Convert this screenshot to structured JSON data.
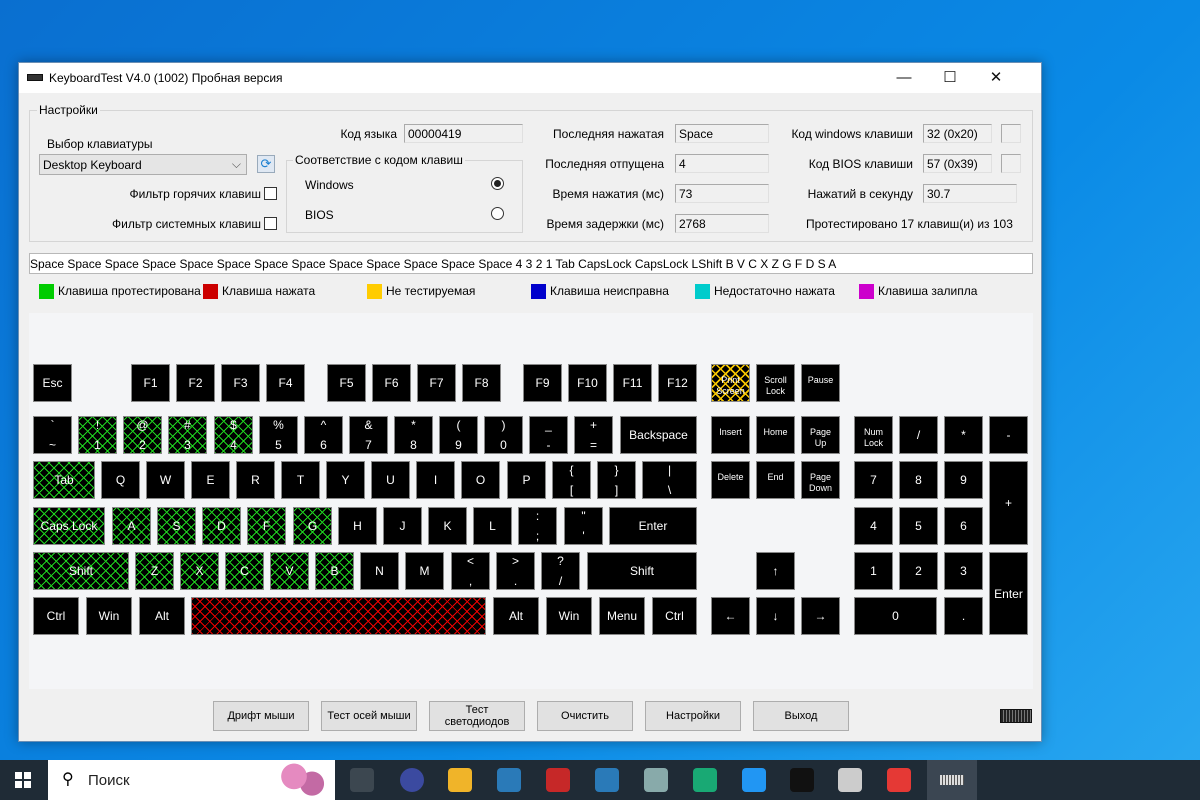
{
  "window": {
    "title": "KeyboardTest V4.0 (1002) Пробная версия",
    "minimize": "—",
    "maximize": "☐",
    "close": "✕"
  },
  "settings": {
    "group_label": "Настройки",
    "keyboard_select_label": "Выбор клавиатуры",
    "keyboard_select_value": "Desktop Keyboard",
    "hotkey_filter_label": "Фильтр горячих клавиш",
    "hotkey_filter_checked": false,
    "system_filter_label": "Фильтр системных клавиш",
    "system_filter_checked": false,
    "lang_code_label": "Код языка",
    "lang_code_value": "00000419",
    "mapping_group_label": "Соответствие с кодом клавиш",
    "mapping_options": [
      {
        "label": "Windows",
        "selected": true
      },
      {
        "label": "BIOS",
        "selected": false
      }
    ],
    "last_pressed_label": "Последняя нажатая",
    "last_pressed_value": "Space",
    "last_released_label": "Последняя отпущена",
    "last_released_value": "4",
    "press_time_label": "Время нажатия (мс)",
    "press_time_value": "73",
    "delay_time_label": "Время задержки (мс)",
    "delay_time_value": "2768",
    "win_code_label": "Код windows клавиши",
    "win_code_value": "32 (0x20)",
    "bios_code_label": "Код BIOS клавиши",
    "bios_code_value": "57 (0x39)",
    "per_second_label": "Нажатий в секунду",
    "per_second_value": "30.7",
    "tested_summary": "Протестировано 17 клавиш(и) из 103"
  },
  "log": "Space Space Space Space Space Space Space Space Space Space Space Space Space 4 3 2 1 Tab CapsLock CapsLock LShift B V C X Z G F D S A",
  "legend": [
    {
      "label": "Клавиша протестирована",
      "color": "#00cc00"
    },
    {
      "label": "Клавиша нажата",
      "color": "#cc0000"
    },
    {
      "label": "Не тестируемая",
      "color": "#ffcc00"
    },
    {
      "label": "Клавиша неисправна",
      "color": "#0000cc"
    },
    {
      "label": "Недостаточно нажата",
      "color": "#00cccc"
    },
    {
      "label": "Клавиша залипла",
      "color": "#cc00cc"
    }
  ],
  "keyboard": {
    "keys": [
      {
        "id": "esc",
        "label": "Esc"
      },
      {
        "id": "f1",
        "label": "F1"
      },
      {
        "id": "f2",
        "label": "F2"
      },
      {
        "id": "f3",
        "label": "F3"
      },
      {
        "id": "f4",
        "label": "F4"
      },
      {
        "id": "f5",
        "label": "F5"
      },
      {
        "id": "f6",
        "label": "F6"
      },
      {
        "id": "f7",
        "label": "F7"
      },
      {
        "id": "f8",
        "label": "F8"
      },
      {
        "id": "f9",
        "label": "F9"
      },
      {
        "id": "f10",
        "label": "F10"
      },
      {
        "id": "f11",
        "label": "F11"
      },
      {
        "id": "f12",
        "label": "F12"
      },
      {
        "id": "prtsc",
        "label": "Print Screen",
        "state": "untested"
      },
      {
        "id": "scroll",
        "label": "Scroll Lock"
      },
      {
        "id": "pause",
        "label": "Pause"
      },
      {
        "id": "tilde",
        "top": "`",
        "bottom": "~"
      },
      {
        "id": "k1",
        "top": "!",
        "bottom": "1",
        "state": "tested"
      },
      {
        "id": "k2",
        "top": "@",
        "bottom": "2",
        "state": "tested"
      },
      {
        "id": "k3",
        "top": "#",
        "bottom": "3",
        "state": "tested"
      },
      {
        "id": "k4",
        "top": "$",
        "bottom": "4",
        "state": "tested"
      },
      {
        "id": "k5",
        "top": "%",
        "bottom": "5"
      },
      {
        "id": "k6",
        "top": "^",
        "bottom": "6"
      },
      {
        "id": "k7",
        "top": "&",
        "bottom": "7"
      },
      {
        "id": "k8",
        "top": "*",
        "bottom": "8"
      },
      {
        "id": "k9",
        "top": "(",
        "bottom": "9"
      },
      {
        "id": "k0",
        "top": ")",
        "bottom": "0"
      },
      {
        "id": "minus",
        "top": "_",
        "bottom": "-"
      },
      {
        "id": "equal",
        "top": "+",
        "bottom": "="
      },
      {
        "id": "bksp",
        "label": "Backspace"
      },
      {
        "id": "tab",
        "label": "Tab",
        "state": "tested"
      },
      {
        "id": "q",
        "label": "Q"
      },
      {
        "id": "w",
        "label": "W"
      },
      {
        "id": "e",
        "label": "E"
      },
      {
        "id": "r",
        "label": "R"
      },
      {
        "id": "t",
        "label": "T"
      },
      {
        "id": "y",
        "label": "Y"
      },
      {
        "id": "u",
        "label": "U"
      },
      {
        "id": "i",
        "label": "I"
      },
      {
        "id": "o",
        "label": "O"
      },
      {
        "id": "p",
        "label": "P"
      },
      {
        "id": "lbr",
        "top": "{",
        "bottom": "["
      },
      {
        "id": "rbr",
        "top": "}",
        "bottom": "]"
      },
      {
        "id": "bslash",
        "top": "|",
        "bottom": "\\"
      },
      {
        "id": "caps",
        "label": "Caps Lock",
        "state": "tested"
      },
      {
        "id": "a",
        "label": "A",
        "state": "tested"
      },
      {
        "id": "s",
        "label": "S",
        "state": "tested"
      },
      {
        "id": "d",
        "label": "D",
        "state": "tested"
      },
      {
        "id": "f",
        "label": "F",
        "state": "tested"
      },
      {
        "id": "g",
        "label": "G",
        "state": "tested"
      },
      {
        "id": "h",
        "label": "H"
      },
      {
        "id": "j",
        "label": "J"
      },
      {
        "id": "k",
        "label": "K"
      },
      {
        "id": "l",
        "label": "L"
      },
      {
        "id": "semi",
        "top": ":",
        "bottom": ";"
      },
      {
        "id": "quote",
        "top": "\"",
        "bottom": "'"
      },
      {
        "id": "enter",
        "label": "Enter"
      },
      {
        "id": "lshift",
        "label": "Shift",
        "state": "tested"
      },
      {
        "id": "z",
        "label": "Z",
        "state": "tested"
      },
      {
        "id": "x",
        "label": "X",
        "state": "tested"
      },
      {
        "id": "c",
        "label": "C",
        "state": "tested"
      },
      {
        "id": "v",
        "label": "V",
        "state": "tested"
      },
      {
        "id": "b",
        "label": "B",
        "state": "tested"
      },
      {
        "id": "n",
        "label": "N"
      },
      {
        "id": "m",
        "label": "M"
      },
      {
        "id": "comma",
        "top": "<",
        "bottom": ","
      },
      {
        "id": "period",
        "top": ">",
        "bottom": "."
      },
      {
        "id": "slash",
        "top": "?",
        "bottom": "/"
      },
      {
        "id": "rshift",
        "label": "Shift"
      },
      {
        "id": "lctrl",
        "label": "Ctrl"
      },
      {
        "id": "lwin",
        "label": "Win"
      },
      {
        "id": "lalt",
        "label": "Alt"
      },
      {
        "id": "space",
        "label": "",
        "state": "pressed"
      },
      {
        "id": "ralt",
        "label": "Alt"
      },
      {
        "id": "rwin",
        "label": "Win"
      },
      {
        "id": "menu",
        "label": "Menu"
      },
      {
        "id": "rctrl",
        "label": "Ctrl"
      },
      {
        "id": "ins",
        "label": "Insert"
      },
      {
        "id": "home",
        "label": "Home"
      },
      {
        "id": "pgup",
        "label": "Page Up"
      },
      {
        "id": "del",
        "label": "Delete"
      },
      {
        "id": "end",
        "label": "End"
      },
      {
        "id": "pgdn",
        "label": "Page Down"
      },
      {
        "id": "up",
        "label": "↑"
      },
      {
        "id": "left",
        "label": "←"
      },
      {
        "id": "down",
        "label": "↓"
      },
      {
        "id": "right",
        "label": "→"
      },
      {
        "id": "numlock",
        "label": "Num Lock"
      },
      {
        "id": "ndiv",
        "label": "/"
      },
      {
        "id": "nmul",
        "label": "*"
      },
      {
        "id": "nsub",
        "label": "-"
      },
      {
        "id": "n7",
        "label": "7"
      },
      {
        "id": "n8",
        "label": "8"
      },
      {
        "id": "n9",
        "label": "9"
      },
      {
        "id": "nadd",
        "label": "+"
      },
      {
        "id": "n4",
        "label": "4"
      },
      {
        "id": "n5",
        "label": "5"
      },
      {
        "id": "n6",
        "label": "6"
      },
      {
        "id": "n1",
        "label": "1"
      },
      {
        "id": "n2",
        "label": "2"
      },
      {
        "id": "n3",
        "label": "3"
      },
      {
        "id": "nenter",
        "label": "Enter"
      },
      {
        "id": "n0",
        "label": "0"
      },
      {
        "id": "ndot",
        "label": "."
      }
    ]
  },
  "buttons": [
    {
      "label": "Дрифт мыши"
    },
    {
      "label": "Тест осей мыши"
    },
    {
      "label": "Тест светодиодов"
    },
    {
      "label": "Очистить"
    },
    {
      "label": "Настройки"
    },
    {
      "label": "Выход"
    }
  ],
  "taskbar": {
    "search_placeholder": "Поиск",
    "icons": [
      "task-view",
      "yandex-browser",
      "file-explorer",
      "mail-app",
      "ccleaner",
      "mail-app-2",
      "network-monitor",
      "chat-app",
      "messenger",
      "terminal",
      "paint",
      "anydesk",
      "keyboardtest"
    ]
  }
}
